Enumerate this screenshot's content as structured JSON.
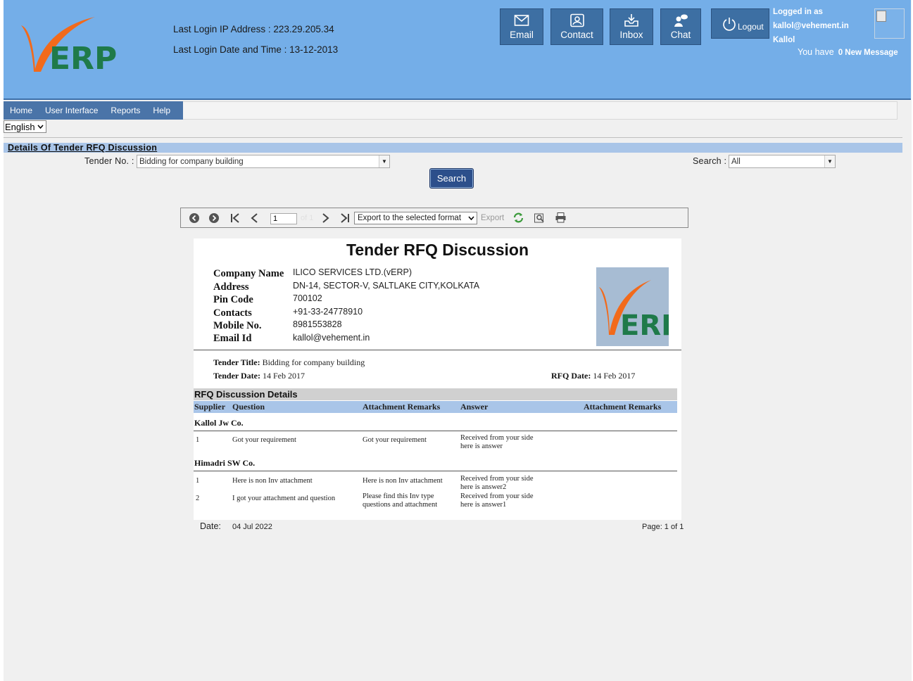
{
  "header": {
    "logo_text": "ERP",
    "last_login_ip_label": "Last Login IP Address :",
    "last_login_ip": "223.29.205.34",
    "last_login_date_label": "Last Login Date and Time :",
    "last_login_date": "13-12-2013",
    "buttons": [
      {
        "label": "Email",
        "icon": "envelope-icon"
      },
      {
        "label": "Contact",
        "icon": "contact-card-icon"
      },
      {
        "label": "Inbox",
        "icon": "inbox-tray-icon"
      },
      {
        "label": "Chat",
        "icon": "chat-users-icon"
      }
    ],
    "logout_label": "Logout",
    "logged_in_label": "Logged in as",
    "user_email": "kallol@vehement.in",
    "user_name": "Kallol",
    "you_have": "You have",
    "new_message": "0 New Message"
  },
  "menu": {
    "items": [
      "Home",
      "User Interface",
      "Reports",
      "Help"
    ]
  },
  "language": {
    "selected": "English"
  },
  "section": {
    "title": "Details Of Tender RFQ Discussion"
  },
  "filters": {
    "tender_label": "Tender No. :",
    "tender_value": "Bidding for company building",
    "search_label": "Search :",
    "search_value": "All",
    "search_button": "Search"
  },
  "viewer": {
    "page_value": "1",
    "page_of": "of 1",
    "export_format": "Export to the selected format",
    "export_label": "Export"
  },
  "report": {
    "title": "Tender RFQ Discussion",
    "company": {
      "labels": [
        "Company Name",
        "Address",
        "Pin Code",
        "Contacts",
        "Mobile No.",
        "Email Id"
      ],
      "values": [
        "ILICO SERVICES LTD.(vERP)",
        "DN-14, SECTOR-V, SALTLAKE CITY,KOLKATA",
        "700102",
        "+91-33-24778910",
        "8981553828",
        "kallol@vehement.in"
      ]
    },
    "tender_title_label": "Tender Title:",
    "tender_title": "Bidding for company building",
    "tender_date_label": "Tender Date:",
    "tender_date": "14 Feb 2017",
    "rfq_date_label": "RFQ Date:",
    "rfq_date": "14 Feb 2017",
    "rfq_section": "RFQ Discussion Details",
    "columns": [
      "Supplier",
      "Question",
      "Attachment Remarks",
      "Answer",
      "Attachment Remarks"
    ],
    "groups": [
      {
        "supplier": "Kallol Jw Co.",
        "rows": [
          {
            "no": "1",
            "question": "Got your requirement",
            "remarks": "Got your requirement",
            "answer_1": "Received from your side",
            "answer_2": "here is answer"
          }
        ]
      },
      {
        "supplier": "Himadri SW Co.",
        "rows": [
          {
            "no": "1",
            "question": "Here is non Inv attachment",
            "remarks": "Here is non Inv attachment",
            "answer_1": "Received from your side",
            "answer_2": "here is answer2"
          },
          {
            "no": "2",
            "question": "I got your attachment and question",
            "remarks_1": "Please find this Inv type",
            "remarks_2": "questions and attachment",
            "answer_1": "Received from your side",
            "answer_2": "here is answer1"
          }
        ]
      }
    ],
    "footer_date_label": "Date:",
    "footer_date": "04 Jul 2022",
    "page_info": "Page: 1 of 1"
  },
  "colors": {
    "header_bg": "#74aee8",
    "button_bg": "#3d6fa3",
    "menu_bg": "#4a74a8",
    "accent_orange": "#f26a1b",
    "logo_green": "#1f7a4a"
  }
}
